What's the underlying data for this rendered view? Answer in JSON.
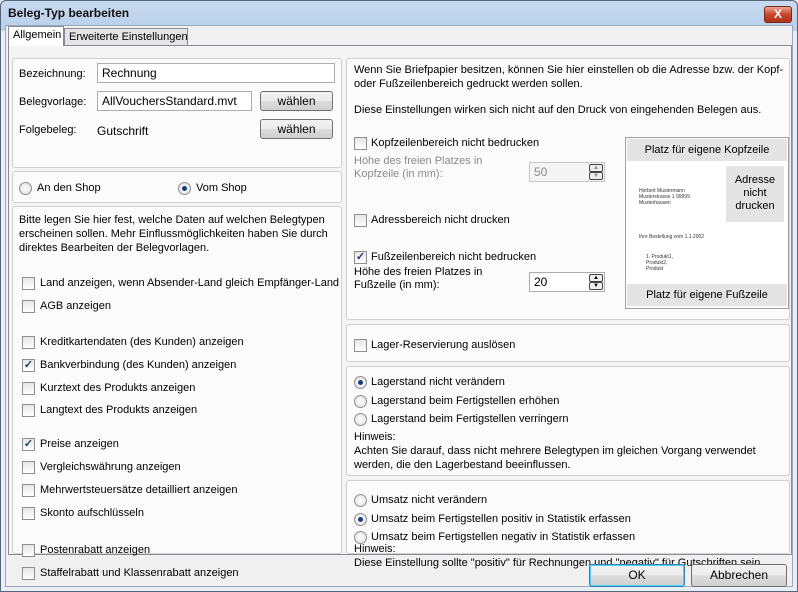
{
  "window": {
    "title": "Beleg-Typ bearbeiten",
    "close_label": "X"
  },
  "tabs": [
    {
      "label": "Allgemein"
    },
    {
      "label": "Erweiterte Einstellungen"
    }
  ],
  "general": {
    "bezeichnung_label": "Bezeichnung:",
    "bezeichnung_value": "Rechnung",
    "belegvorlage_label": "Belegvorlage:",
    "belegvorlage_value": "AllVouchersStandard.mvt",
    "choose_label": "wählen",
    "folgebeleg_label": "Folgebeleg:",
    "folgebeleg_value": "Gutschrift"
  },
  "shop": {
    "an_den_shop": "An den Shop",
    "vom_shop": "Vom Shop"
  },
  "data_options": {
    "intro": [
      "Bitte legen Sie hier fest, welche Daten auf welchen Belegtypen",
      "erscheinen sollen. Mehr Einflussmöglichkeiten haben Sie durch",
      "direktes Bearbeiten der Belegvorlagen."
    ],
    "items": [
      {
        "label": "Land anzeigen, wenn Absender-Land gleich Empfänger-Land",
        "checked": false
      },
      {
        "label": "AGB anzeigen",
        "checked": false
      },
      {
        "label": "Kreditkartendaten (des Kunden) anzeigen",
        "checked": false
      },
      {
        "label": "Bankverbindung (des Kunden) anzeigen",
        "checked": true
      },
      {
        "label": "Kurztext des Produkts anzeigen",
        "checked": false
      },
      {
        "label": "Langtext des Produkts anzeigen",
        "checked": false
      },
      {
        "label": "Preise anzeigen",
        "checked": true
      },
      {
        "label": "Vergleichswährung anzeigen",
        "checked": false
      },
      {
        "label": "Mehrwertsteuersätze detailliert anzeigen",
        "checked": false
      },
      {
        "label": "Skonto aufschlüsseln",
        "checked": false
      },
      {
        "label": "Postenrabatt anzeigen",
        "checked": false
      },
      {
        "label": "Staffelrabatt und Klassenrabatt anzeigen",
        "checked": false
      }
    ]
  },
  "letterhead": {
    "intro": [
      "Wenn Sie Briefpapier besitzen, können Sie hier einstellen ob die Adresse bzw. der Kopf-",
      "oder Fußzeilenbereich gedruckt werden sollen."
    ],
    "note": "Diese Einstellungen wirken sich nicht auf den Druck von eingehenden Belegen aus.",
    "header_checkbox": "Kopfzeilenbereich nicht bedrucken",
    "header_height_label": [
      "Höhe des freien Platzes in",
      "Kopfzeile (in mm):"
    ],
    "header_height_value": "50",
    "address_checkbox": "Adressbereich nicht drucken",
    "footer_checkbox": "Fußzeilenbereich nicht bedrucken",
    "footer_height_label": [
      "Höhe des freien Platzes in",
      "Fußzeile (in mm):"
    ],
    "footer_height_value": "20"
  },
  "preview": {
    "header": "Platz für eigene Kopfzeile",
    "address": [
      "Adresse",
      "nicht",
      "drucken"
    ],
    "sender": [
      "Herbert Mustermann",
      "Musterstrasse 1 99999",
      "Musterhausen"
    ],
    "order": "Ihre Bestellung vom 1.1.2002",
    "products": [
      "1. Produkt1,",
      "Produkt2,",
      "Produkt"
    ],
    "footer": "Platz für eigene Fußzeile"
  },
  "stock_reservation": {
    "label": "Lager-Reservierung auslösen"
  },
  "stock": {
    "options": [
      "Lagerstand nicht verändern",
      "Lagerstand beim Fertigstellen erhöhen",
      "Lagerstand beim Fertigstellen verringern"
    ],
    "hint_title": "Hinweis:",
    "hint": [
      "Achten Sie darauf, dass nicht mehrere Belegtypen im gleichen Vorgang verwendet",
      "werden, die den Lagerbestand beeinflussen."
    ]
  },
  "revenue": {
    "options": [
      "Umsatz nicht verändern",
      "Umsatz beim Fertigstellen positiv in Statistik erfassen",
      "Umsatz beim Fertigstellen negativ in Statistik erfassen"
    ],
    "hint_title": "Hinweis:",
    "hint": "Diese Einstellung sollte \"positiv\" für Rechnungen und \"negativ\" für Gutschriften sein."
  },
  "footer_buttons": {
    "ok": "OK",
    "cancel": "Abbrechen"
  }
}
